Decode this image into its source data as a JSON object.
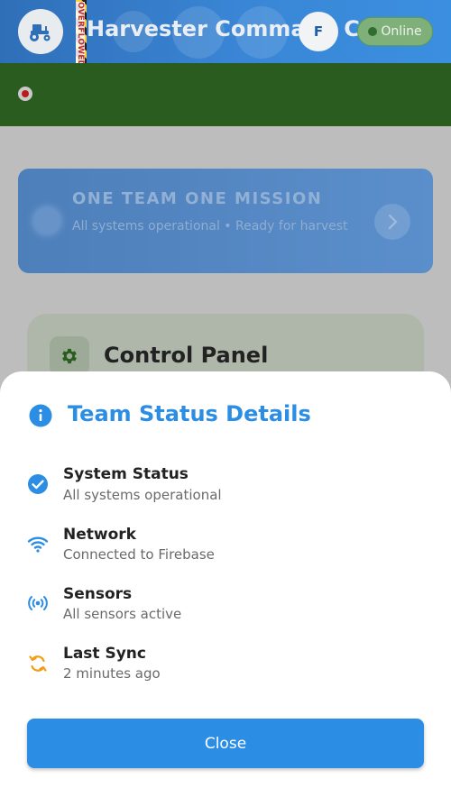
{
  "header": {
    "title": "Harvester Command Center",
    "overflow_warning": "OVERFLOWED BY 2",
    "avatar_initial": "F",
    "status_label": "Online",
    "logo_icon": "tractor-icon"
  },
  "mission": {
    "title": "ONE TEAM ONE MISSION",
    "subtitle": "All systems operational • Ready for harvest"
  },
  "control_panel": {
    "title": "Control Panel",
    "icon": "gear-icon"
  },
  "sheet": {
    "title": "Team Status Details",
    "items": [
      {
        "label": "System Status",
        "value": "All systems operational",
        "icon": "check-circle-icon",
        "color": "#2b8de3"
      },
      {
        "label": "Network",
        "value": "Connected to Firebase",
        "icon": "wifi-icon",
        "color": "#2b8de3"
      },
      {
        "label": "Sensors",
        "value": "All sensors active",
        "icon": "sensors-icon",
        "color": "#2b8de3"
      },
      {
        "label": "Last Sync",
        "value": "2 minutes ago",
        "icon": "sync-icon",
        "color": "#f39c12"
      }
    ],
    "close_label": "Close"
  },
  "colors": {
    "accent": "#2b8de3",
    "header_blue": "#3a86d6",
    "header_green": "#2a5c1f",
    "sync_orange": "#f39c12"
  }
}
